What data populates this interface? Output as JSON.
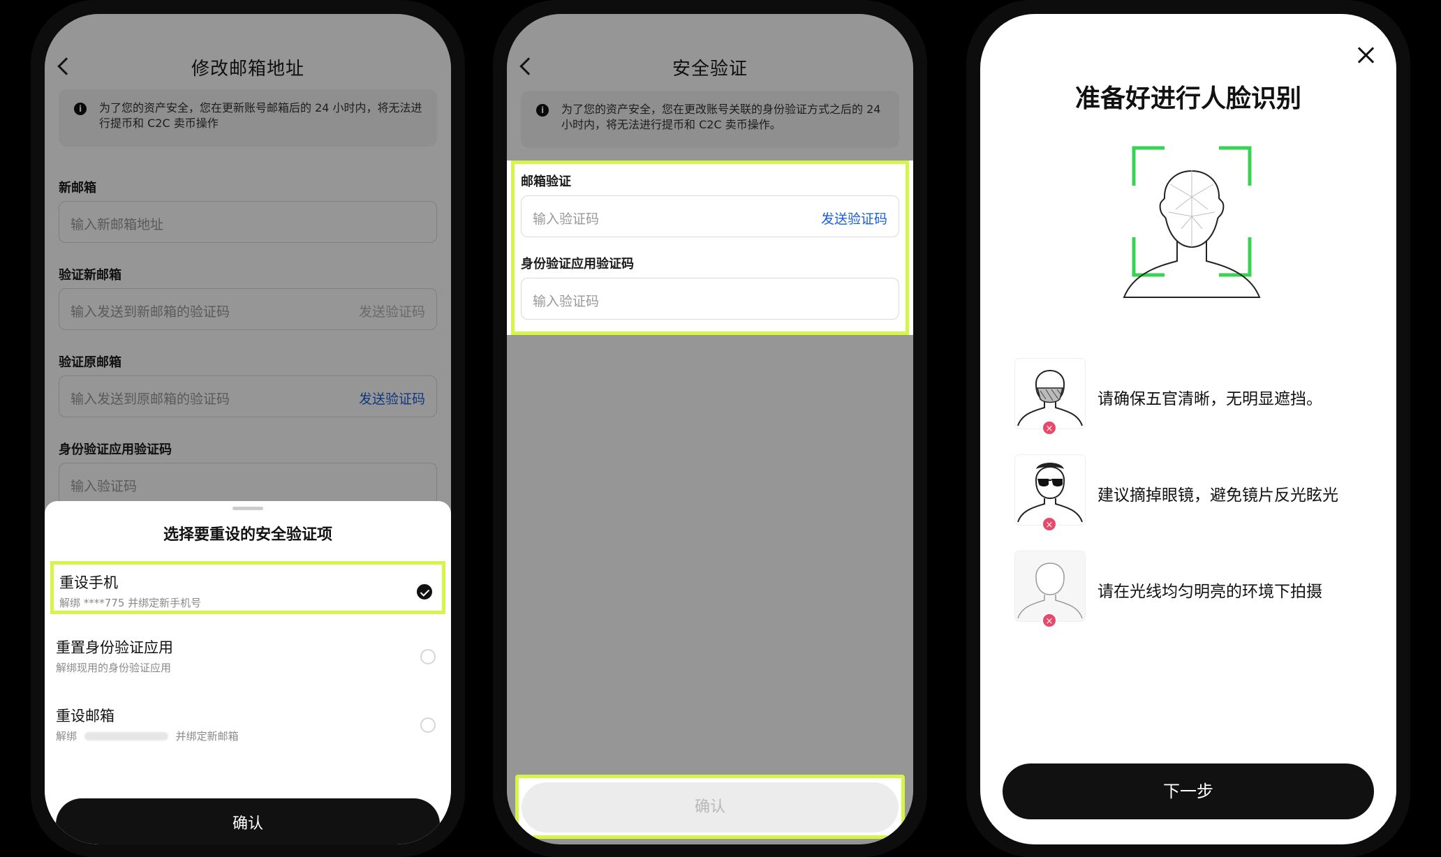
{
  "phone1": {
    "title": "修改邮箱地址",
    "notice": "为了您的资产安全，您在更新账号邮箱后的 24 小时内，将无法进行提币和 C2C 卖币操作",
    "new_email_label": "新邮箱",
    "new_email_placeholder": "输入新邮箱地址",
    "verify_new_label": "验证新邮箱",
    "verify_new_placeholder": "输入发送到新邮箱的验证码",
    "verify_new_action": "发送验证码",
    "verify_old_label": "验证原邮箱",
    "verify_old_placeholder": "输入发送到原邮箱的验证码",
    "verify_old_action": "发送验证码",
    "auth_label": "身份验证应用验证码",
    "auth_placeholder": "输入验证码",
    "sheet": {
      "title": "选择要重设的安全验证项",
      "options": [
        {
          "title": "重设手机",
          "sub": "解绑 ****775 并绑定新手机号",
          "selected": true
        },
        {
          "title": "重置身份验证应用",
          "sub": "解绑现用的身份验证应用",
          "selected": false
        },
        {
          "title": "重设邮箱",
          "sub_a": "解绑",
          "sub_b": "并绑定新邮箱",
          "selected": false
        }
      ],
      "confirm": "确认"
    }
  },
  "phone2": {
    "title": "安全验证",
    "notice": "为了您的资产安全，您在更改账号关联的身份验证方式之后的 24 小时内，将无法进行提币和 C2C 卖币操作。",
    "email_label": "邮箱验证",
    "email_placeholder": "输入验证码",
    "email_action": "发送验证码",
    "auth_label": "身份验证应用验证码",
    "auth_placeholder": "输入验证码",
    "confirm": "确认"
  },
  "phone3": {
    "title": "准备好进行人脸识别",
    "tips": [
      "请确保五官清晰，无明显遮挡。",
      "建议摘掉眼镜，避免镜片反光眩光",
      "请在光线均匀明亮的环境下拍摄"
    ],
    "next": "下一步"
  },
  "colors": {
    "highlight": "#d6f54a",
    "link": "#1a5fd6",
    "error_badge": "#e8486a",
    "frame_green": "#39d353"
  }
}
